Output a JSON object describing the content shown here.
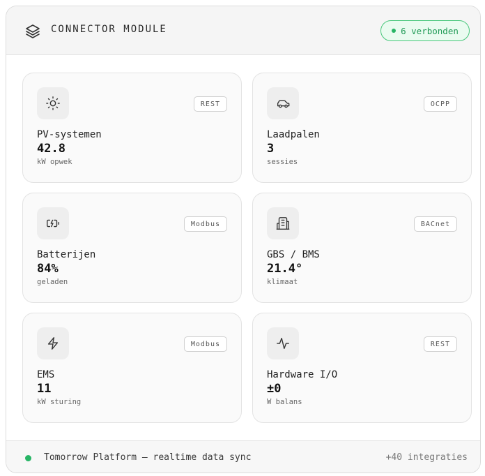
{
  "header": {
    "title": "CONNECTOR MODULE",
    "status_badge": "6 verbonden",
    "icon": "layers-icon"
  },
  "cards": [
    {
      "icon": "sun-icon",
      "protocol": "REST",
      "name": "PV-systemen",
      "value": "42.8",
      "unit": "kW opwek"
    },
    {
      "icon": "car-icon",
      "protocol": "OCPP",
      "name": "Laadpalen",
      "value": "3",
      "unit": "sessies"
    },
    {
      "icon": "battery-charging-icon",
      "protocol": "Modbus",
      "name": "Batterijen",
      "value": "84%",
      "unit": "geladen"
    },
    {
      "icon": "building-icon",
      "protocol": "BACnet",
      "name": "GBS / BMS",
      "value": "21.4°",
      "unit": "klimaat"
    },
    {
      "icon": "zap-icon",
      "protocol": "Modbus",
      "name": "EMS",
      "value": "11",
      "unit": "kW sturing"
    },
    {
      "icon": "activity-icon",
      "protocol": "REST",
      "name": "Hardware I/O",
      "value": "±0",
      "unit": "W balans"
    }
  ],
  "footer": {
    "sync_text": "Tomorrow Platform — realtime data sync",
    "integrations": "+40 integraties"
  },
  "colors": {
    "accent_green": "#27b565",
    "badge_bg": "#eafbf0",
    "card_bg": "#fafafa",
    "header_bg": "#f5f5f5"
  }
}
